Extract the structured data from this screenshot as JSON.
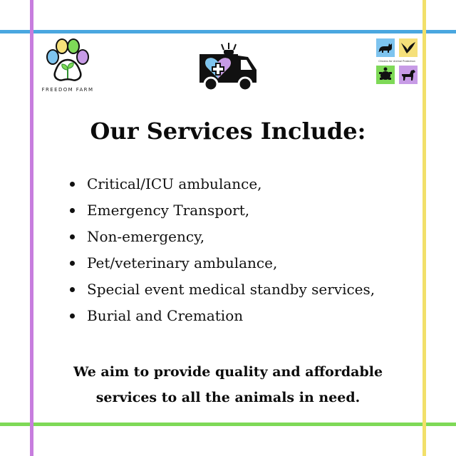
{
  "colors": {
    "line_top": "#4aa7e0",
    "line_bottom": "#7ed957",
    "line_left": "#c77dde",
    "line_right": "#f2e06a",
    "paw_blue": "#7ec4ef",
    "paw_yellow": "#f5e07a",
    "paw_purple": "#c79be6",
    "paw_green": "#7ed957",
    "tile_blue": "#7ec4ef",
    "tile_yellow": "#f5e07a",
    "tile_green": "#7ed957",
    "tile_purple": "#c79be6"
  },
  "logos": {
    "left_text": "FREEDOM FARM",
    "left_icon": "paw-sprout-icon",
    "center_icon": "ambulance-heart-icon",
    "right_text": "Citizens for Animal Protection",
    "right_icons": [
      "cat-icon",
      "bird-icon",
      "turtle-icon",
      "dog-icon"
    ]
  },
  "title": "Our Services Include:",
  "services": [
    "Critical/ICU ambulance,",
    "Emergency Transport,",
    "Non-emergency,",
    "Pet/veterinary ambulance,",
    "Special event medical standby services,",
    "Burial and Cremation"
  ],
  "tagline_line1": "We aim to provide quality and affordable",
  "tagline_line2": "services to all the animals in need."
}
